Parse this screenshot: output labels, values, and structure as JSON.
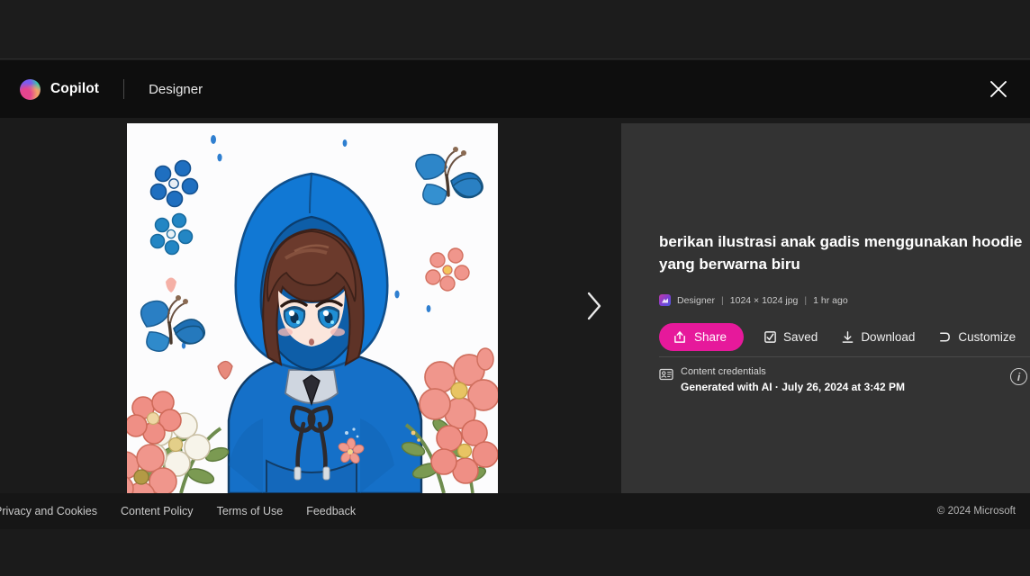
{
  "header": {
    "brand_name": "Copilot",
    "app_name": "Designer",
    "close_icon": "close-icon"
  },
  "gallery": {
    "next_icon": "chevron-right-icon",
    "image_alt": "anime girl wearing a blue hoodie surrounded by flowers and butterflies"
  },
  "details": {
    "prompt": "berikan ilustrasi anak gadis menggunakan hoodie yang berwarna biru",
    "meta": {
      "source": "Designer",
      "dimensions": "1024 × 1024 jpg",
      "age": "1 hr ago",
      "separator": "|"
    },
    "actions": [
      {
        "label": "Share",
        "icon": "share-icon",
        "primary": true
      },
      {
        "label": "Saved",
        "icon": "bookmark-check-icon",
        "primary": false
      },
      {
        "label": "Download",
        "icon": "download-icon",
        "primary": false
      },
      {
        "label": "Customize",
        "icon": "wand-icon",
        "primary": false
      }
    ],
    "credentials": {
      "icon": "content-credentials-icon",
      "title": "Content credentials",
      "subtitle": "Generated with AI · July 26, 2024 at 3:42 PM",
      "info_label": "i"
    }
  },
  "footer": {
    "links": [
      "Privacy and Cookies",
      "Content Policy",
      "Terms of Use",
      "Feedback"
    ],
    "copyright": "© 2024 Microsoft"
  },
  "colors": {
    "accent_pink": "#e6199b",
    "panel_bg": "#333333",
    "page_bg": "#1b1b1b",
    "header_bg": "#0e0e0e",
    "footer_bg": "#161616",
    "hoodie_blue": "#1570c8",
    "hair_brown": "#6b3a2c",
    "flower_pink": "#f0968c"
  }
}
